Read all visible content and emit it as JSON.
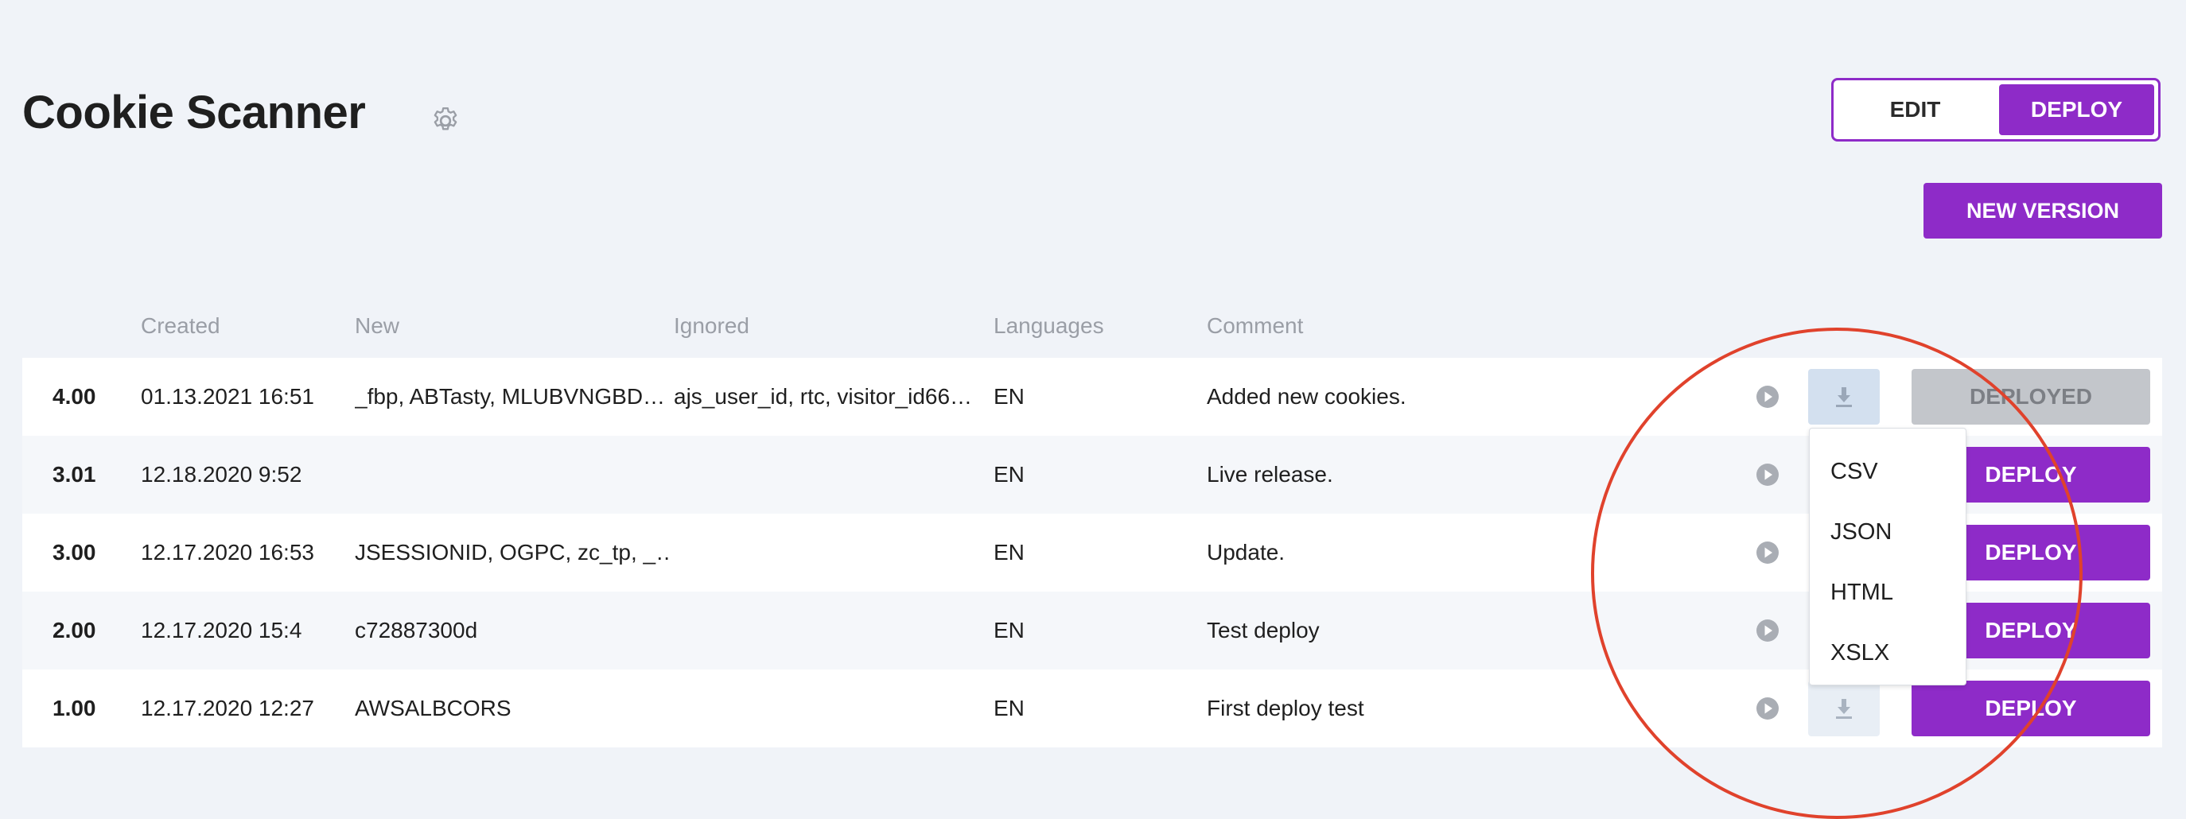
{
  "header": {
    "title": "Cookie Scanner",
    "settings_icon": "gear-icon",
    "mode_edit": "EDIT",
    "mode_deploy": "DEPLOY",
    "new_version": "NEW VERSION"
  },
  "table": {
    "columns": [
      "",
      "Created",
      "New",
      "Ignored",
      "Languages",
      "Comment"
    ],
    "rows": [
      {
        "version": "4.00",
        "created": "01.13.2021 16:51",
        "new": "_fbp, ABTasty, MLUBVNGBD…",
        "ignored": "ajs_user_id, rtc, visitor_id66…",
        "languages": "EN",
        "comment": "Added new cookies.",
        "action": "DEPLOYED"
      },
      {
        "version": "3.01",
        "created": "12.18.2020 9:52",
        "new": "",
        "ignored": "",
        "languages": "EN",
        "comment": "Live release.",
        "action": "DEPLOY"
      },
      {
        "version": "3.00",
        "created": "12.17.2020 16:53",
        "new": "JSESSIONID, OGPC, zc_tp, _…",
        "ignored": "",
        "languages": "EN",
        "comment": "Update.",
        "action": "DEPLOY"
      },
      {
        "version": "2.00",
        "created": "12.17.2020 15:4",
        "new": "c72887300d",
        "ignored": "",
        "languages": "EN",
        "comment": "Test deploy",
        "action": "DEPLOY"
      },
      {
        "version": "1.00",
        "created": "12.17.2020 12:27",
        "new": "AWSALBCORS",
        "ignored": "",
        "languages": "EN",
        "comment": "First deploy test",
        "action": "DEPLOY"
      }
    ]
  },
  "download_menu": {
    "options": [
      "CSV",
      "JSON",
      "HTML",
      "XSLX"
    ]
  },
  "colors": {
    "accent": "#8e2bc8",
    "annotation": "#e0422c",
    "background": "#f0f3f8"
  }
}
